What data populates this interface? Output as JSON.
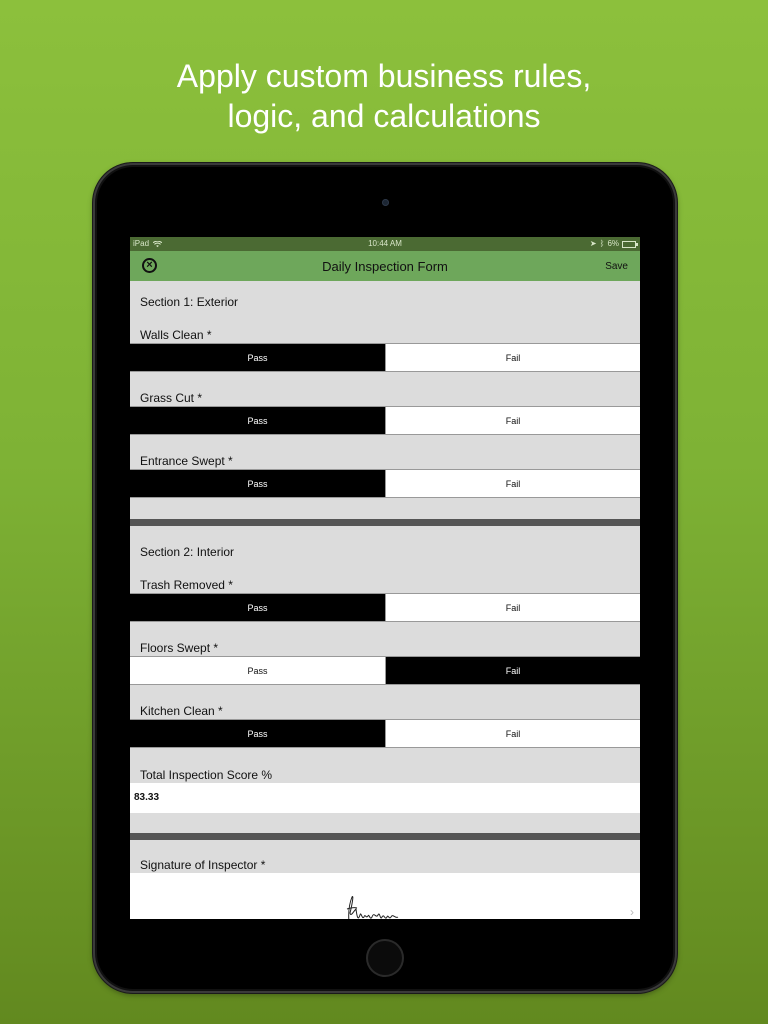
{
  "headline": {
    "line1": "Apply custom business rules,",
    "line2": "logic, and calculations"
  },
  "statusbar": {
    "device": "iPad",
    "time": "10:44 AM",
    "battery": "6%"
  },
  "navbar": {
    "title": "Daily Inspection Form",
    "save_label": "Save",
    "close_glyph": "×"
  },
  "sections": [
    {
      "title": "Section 1: Exterior",
      "fields": [
        {
          "label": "Walls Clean *",
          "options": [
            "Pass",
            "Fail"
          ],
          "selected": "Pass"
        },
        {
          "label": "Grass Cut *",
          "options": [
            "Pass",
            "Fail"
          ],
          "selected": "Pass"
        },
        {
          "label": "Entrance Swept *",
          "options": [
            "Pass",
            "Fail"
          ],
          "selected": "Pass"
        }
      ]
    },
    {
      "title": "Section 2: Interior",
      "fields": [
        {
          "label": "Trash Removed *",
          "options": [
            "Pass",
            "Fail"
          ],
          "selected": "Pass"
        },
        {
          "label": "Floors Swept *",
          "options": [
            "Pass",
            "Fail"
          ],
          "selected": "Fail"
        },
        {
          "label": "Kitchen Clean *",
          "options": [
            "Pass",
            "Fail"
          ],
          "selected": "Pass"
        }
      ]
    }
  ],
  "score": {
    "label": "Total Inspection Score %",
    "value": "83.33"
  },
  "signature": {
    "label": "Signature of Inspector *"
  },
  "colors": {
    "background_green": "#7eb235",
    "nav_green": "#6ea75b",
    "selected_segment": "#000000"
  }
}
